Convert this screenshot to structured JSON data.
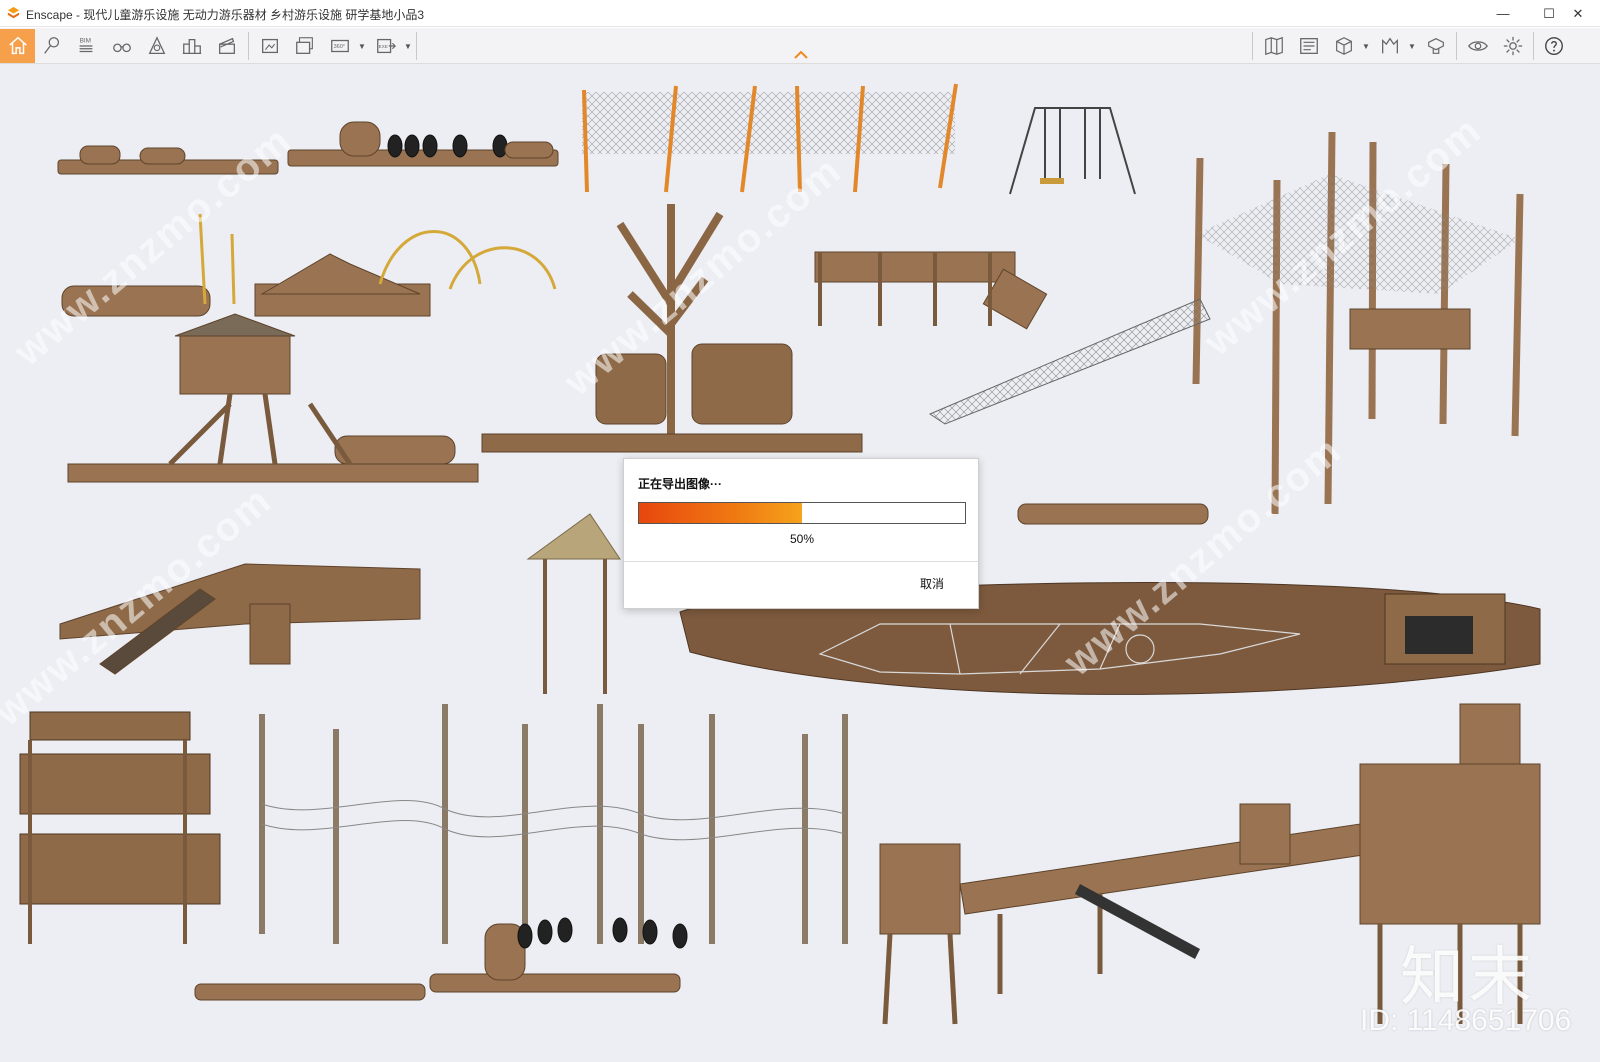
{
  "window": {
    "title": "Enscape - 现代儿童游乐设施 无动力游乐器材 乡村游乐设施 研学基地小品3",
    "minimize_glyph": "—",
    "maximize_glyph": "☐",
    "close_glyph": "✕"
  },
  "toolbar": {
    "bim_label": "BIM",
    "icons_left": [
      "home-icon",
      "pin-icon",
      "bim-icon",
      "binoculars-icon",
      "atmosphere-icon",
      "buildings-icon",
      "clapper-icon",
      "screenshot-icon",
      "batch-render-icon",
      "360-panorama-icon",
      "exe-export-icon"
    ],
    "icons_right": [
      "map-icon",
      "views-icon",
      "cube-icon",
      "asset-library-icon",
      "material-editor-icon",
      "eye-icon",
      "gear-icon",
      "help-icon"
    ],
    "accent_color": "#f7a04b"
  },
  "viewport": {
    "watermark_text": "www.znzmo.com",
    "brand_watermark": "知末",
    "id_watermark": "ID: 1148651706"
  },
  "dialog": {
    "title": "正在导出图像···",
    "progress_percent": 50,
    "progress_label": "50%",
    "cancel_label": "取消"
  }
}
